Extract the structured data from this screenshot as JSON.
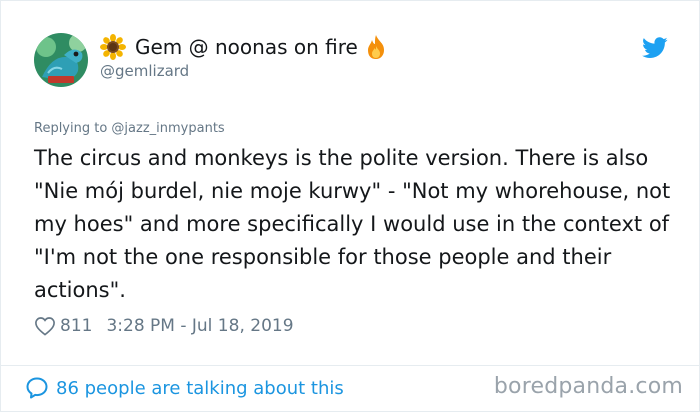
{
  "author": {
    "display_name": "Gem @ noonas on fire",
    "handle": "@gemlizard",
    "avatar_badge": "LIZARD",
    "name_prefix_icon": "sunflower-icon",
    "name_suffix_icon": "fire-icon"
  },
  "tweet": {
    "reply_context": "Replying to @jazz_inmypants",
    "text": "The circus and monkeys is the polite version. There is also \"Nie mój burdel, nie moje kurwy\" - \"Not my whorehouse, not my hoes\" and more specifically I would use in the context of \"I'm not the one responsible for those people and their actions\".",
    "like_count": "811",
    "timestamp": "3:28 PM - Jul 18, 2019"
  },
  "footer": {
    "talking_text": "86 people are talking about this",
    "watermark": "boredpanda.com"
  },
  "colors": {
    "twitter_blue": "#1da1f2",
    "link_blue": "#1b95e0",
    "muted_gray": "#657786",
    "text_dark": "#14171a"
  },
  "icons": {
    "brand": "twitter-bird-icon",
    "like": "heart-icon",
    "replies": "speech-bubble-icon"
  }
}
